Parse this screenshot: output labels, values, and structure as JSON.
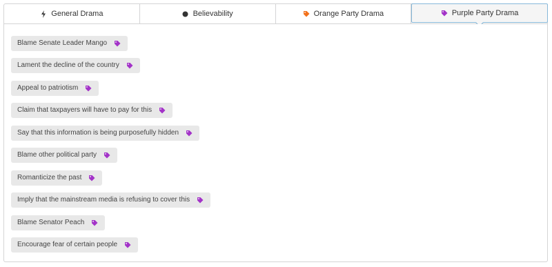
{
  "tabs": [
    {
      "label": "General Drama",
      "icon": "lightning-icon",
      "icon_color": "#333333",
      "active": false
    },
    {
      "label": "Believability",
      "icon": "circle-icon",
      "icon_color": "#333333",
      "active": false
    },
    {
      "label": "Orange Party Drama",
      "icon": "tag-icon",
      "icon_color": "#f2711c",
      "active": false
    },
    {
      "label": "Purple Party Drama",
      "icon": "tag-icon",
      "icon_color": "#a333c8",
      "active": true
    }
  ],
  "tags": [
    {
      "label": "Blame Senate Leader Mango",
      "icon": "tag-icon",
      "icon_color": "#a333c8"
    },
    {
      "label": "Lament the decline of the country",
      "icon": "tag-icon",
      "icon_color": "#a333c8"
    },
    {
      "label": "Appeal to patriotism",
      "icon": "tag-icon",
      "icon_color": "#a333c8"
    },
    {
      "label": "Claim that taxpayers will have to pay for this",
      "icon": "tag-icon",
      "icon_color": "#a333c8"
    },
    {
      "label": "Say that this information is being purposefully hidden",
      "icon": "tag-icon",
      "icon_color": "#a333c8"
    },
    {
      "label": "Blame other political party",
      "icon": "tag-icon",
      "icon_color": "#a333c8"
    },
    {
      "label": "Romanticize the past",
      "icon": "tag-icon",
      "icon_color": "#a333c8"
    },
    {
      "label": "Imply that the mainstream media is refusing to cover this",
      "icon": "tag-icon",
      "icon_color": "#a333c8"
    },
    {
      "label": "Blame Senator Peach",
      "icon": "tag-icon",
      "icon_color": "#a333c8"
    },
    {
      "label": "Encourage fear of certain people",
      "icon": "tag-icon",
      "icon_color": "#a333c8"
    }
  ]
}
